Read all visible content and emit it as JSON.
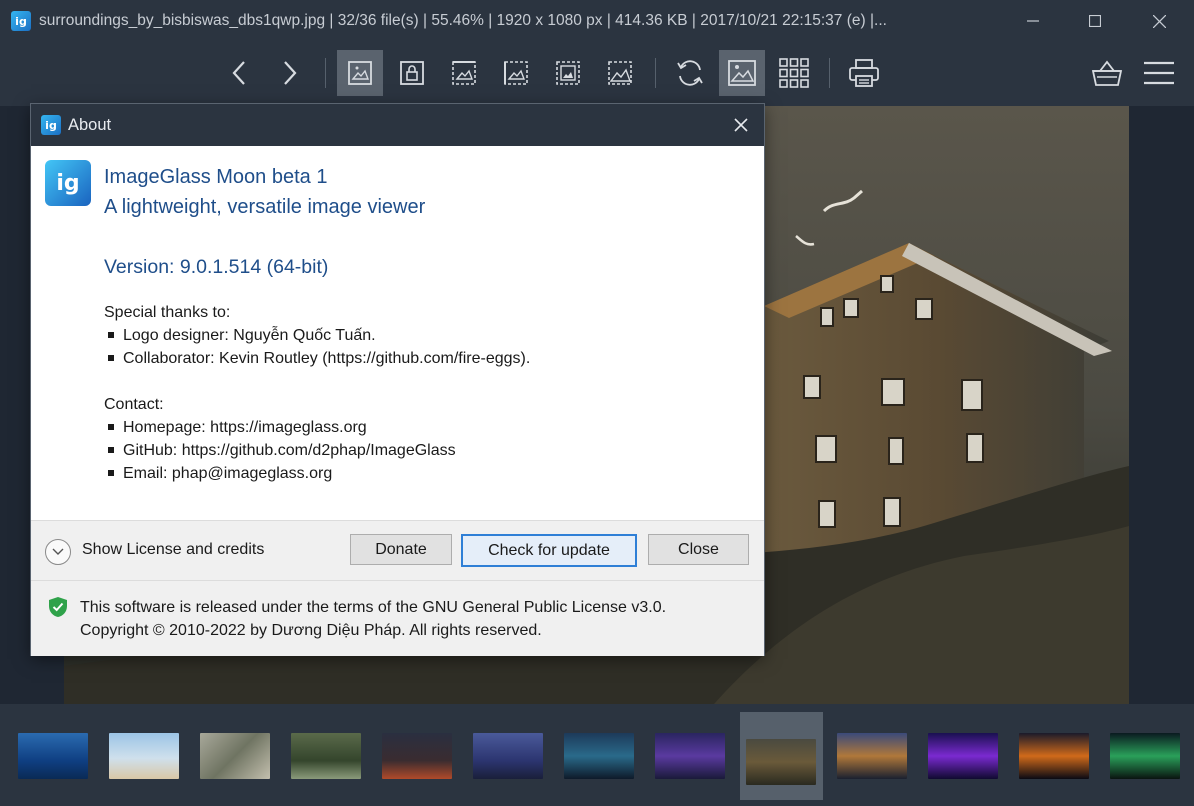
{
  "window": {
    "app_icon_text": "ig",
    "title": "surroundings_by_bisbiswas_dbs1qwp.jpg  |  32/36 file(s)  |  55.46%  |  1920 x 1080 px  |  414.36 KB  |  2017/10/21 22:15:37 (e)  |...",
    "controls": [
      "minimize",
      "maximize",
      "close"
    ]
  },
  "toolbar": {
    "buttons": [
      {
        "icon": "chevron-left-icon"
      },
      {
        "icon": "chevron-right-icon"
      },
      {
        "icon": "auto-zoom-icon",
        "active": true
      },
      {
        "icon": "lock-zoom-icon"
      },
      {
        "icon": "scale-width-icon"
      },
      {
        "icon": "scale-height-icon"
      },
      {
        "icon": "scale-to-fit-icon"
      },
      {
        "icon": "scale-to-fill-icon"
      },
      {
        "icon": "refresh-icon"
      },
      {
        "icon": "gallery-icon",
        "active": true
      },
      {
        "icon": "thumbnail-grid-icon"
      },
      {
        "icon": "print-icon"
      },
      {
        "icon": "basket-icon"
      },
      {
        "icon": "menu-icon"
      }
    ]
  },
  "dialog": {
    "title": "About",
    "logo_text": "ig",
    "app_name": "ImageGlass Moon beta 1",
    "app_description": "A lightweight, versatile image viewer",
    "version": "Version: 9.0.1.514 (64-bit)",
    "thanks_heading": "Special thanks to:",
    "thanks": [
      "Logo designer: Nguyễn Quốc Tuấn.",
      "Collaborator: Kevin Routley (https://github.com/fire-eggs)."
    ],
    "contact_heading": "Contact:",
    "contacts": [
      "Homepage: https://imageglass.org",
      "GitHub: https://github.com/d2phap/ImageGlass",
      "Email: phap@imageglass.org"
    ],
    "expand_label": "Show License and credits",
    "buttons": {
      "donate": "Donate",
      "check_update": "Check for update",
      "close": "Close"
    },
    "license_line1": "This software is released under the terms of the GNU General Public License v3.0.",
    "license_line2": "Copyright © 2010-2022 by Dương Diệu Pháp. All rights reserved."
  },
  "thumbnails": {
    "count": 13,
    "selected_index": 8
  },
  "colors": {
    "chrome": "#2b3440",
    "background": "#1f2733",
    "accent_blue": "#1f4e8a",
    "primary_border": "#2f7fd6",
    "shield_green": "#2fa24a"
  }
}
